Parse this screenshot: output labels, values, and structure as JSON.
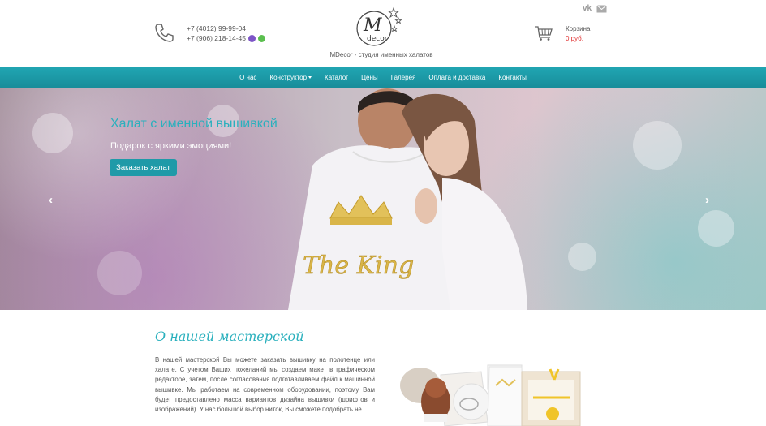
{
  "header": {
    "phone1": "+7 (4012) 99-99-04",
    "phone2": "+7 (906) 218-14-45",
    "logo_letter": "M",
    "logo_word": "decor",
    "tagline": "MDecor - студия именных халатов",
    "social_vk": "vk",
    "cart_label": "Корзина",
    "cart_price": "0 руб.",
    "icons": [
      "phone-icon",
      "viber-icon",
      "whatsapp-icon",
      "vk-icon",
      "mail-icon",
      "cart-icon"
    ]
  },
  "nav": {
    "items": [
      "О нас",
      "Конструктор",
      "Каталог",
      "Цены",
      "Галерея",
      "Оплата и доставка",
      "Контакты"
    ]
  },
  "hero": {
    "title": "Халат с именной вышивкой",
    "subtitle": "Подарок с яркими эмоциями!",
    "button": "Заказать халат",
    "embroidery": "The King",
    "prev": "‹",
    "next": "›"
  },
  "about": {
    "title": "О нашей мастерской",
    "text": "В нашей мастерской Вы можете заказать вышивку на полотенце или халате. С учетом Ваших пожеланий мы создаем макет в графическом редакторе, затем, после согласования подготавливаем файл к машинной вышивке. Мы работаем на современном оборудовании, поэтому Вам будет предоставлено масса вариантов дизайна вышивки (шрифтов и изображений). У нас большой выбор ниток, Вы сможете подобрать не"
  },
  "colors": {
    "accent": "#21a6b3",
    "price": "#e03030"
  }
}
